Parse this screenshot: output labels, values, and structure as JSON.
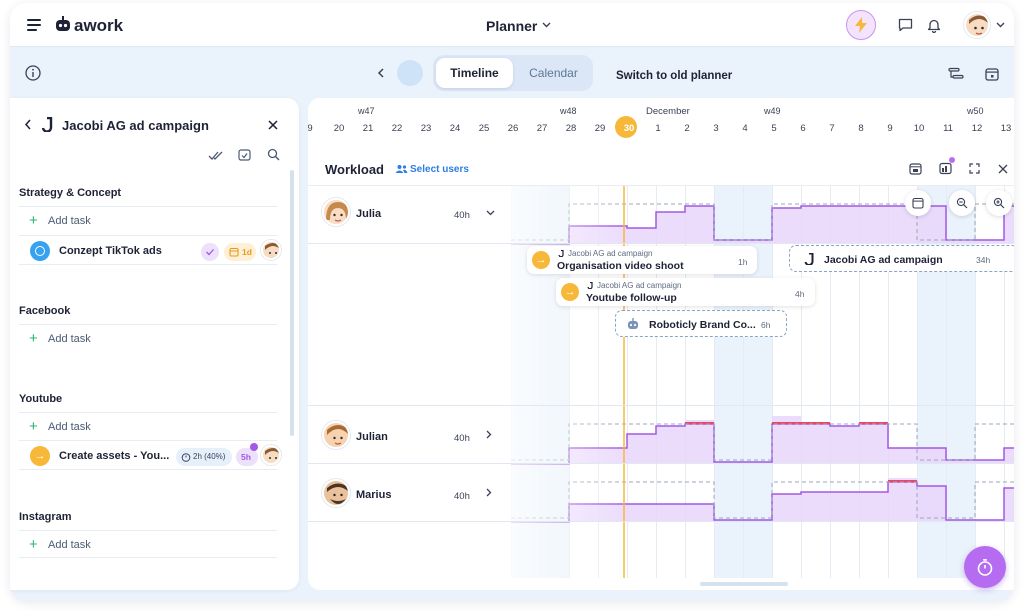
{
  "topbar": {
    "menu_icon": "hamburger-icon",
    "logo": "awork",
    "title": "Planner",
    "lightning_icon": "lightning-icon",
    "chat_icon": "chat-icon",
    "bell_icon": "bell-icon"
  },
  "subbar": {
    "info_icon": "info-icon",
    "tab_timeline": "Timeline",
    "tab_calendar": "Calendar",
    "switch_old": "Switch to old planner"
  },
  "left_panel": {
    "title": "Jacobi AG ad campaign",
    "sections": [
      {
        "title": "Strategy & Concept",
        "add_label": "Add task"
      },
      {
        "title": "Facebook",
        "add_label": "Add task"
      },
      {
        "title": "Youtube",
        "add_label": "Add task"
      },
      {
        "title": "Instagram",
        "add_label": "Add task"
      }
    ],
    "task1": {
      "name": "Conzept TikTok ads",
      "duration": "1d"
    },
    "task2": {
      "name": "Create assets - You...",
      "time": "2h (40%)",
      "hours": "5h"
    }
  },
  "timeline": {
    "weeks": [
      "w47",
      "w48",
      "w49",
      "w50"
    ],
    "month": "December",
    "days": [
      "9",
      "20",
      "21",
      "22",
      "23",
      "24",
      "25",
      "26",
      "27",
      "28",
      "29",
      "30",
      "1",
      "2",
      "3",
      "4",
      "5",
      "6",
      "7",
      "8",
      "9",
      "10",
      "11",
      "12",
      "13"
    ],
    "today": "30"
  },
  "workload": {
    "title": "Workload",
    "select_users": "Select users",
    "people": [
      {
        "name": "Julia",
        "hours": "40h"
      },
      {
        "name": "Julian",
        "hours": "40h"
      },
      {
        "name": "Marius",
        "hours": "40h"
      }
    ],
    "cards": [
      {
        "project": "Jacobi AG ad campaign",
        "title": "Organisation video shoot",
        "hours": "1h"
      },
      {
        "project": "Jacobi AG ad campaign",
        "title": "Youtube follow-up",
        "hours": "4h"
      },
      {
        "project": "",
        "title": "Roboticly Brand Co...",
        "hours": "6h"
      },
      {
        "project": "",
        "title": "Jacobi AG ad campaign",
        "hours": "34h"
      }
    ],
    "colors": {
      "fill": "#e9d6fb",
      "line": "#a259e6",
      "over": "#e8456a",
      "today": "#f7b83a"
    }
  }
}
